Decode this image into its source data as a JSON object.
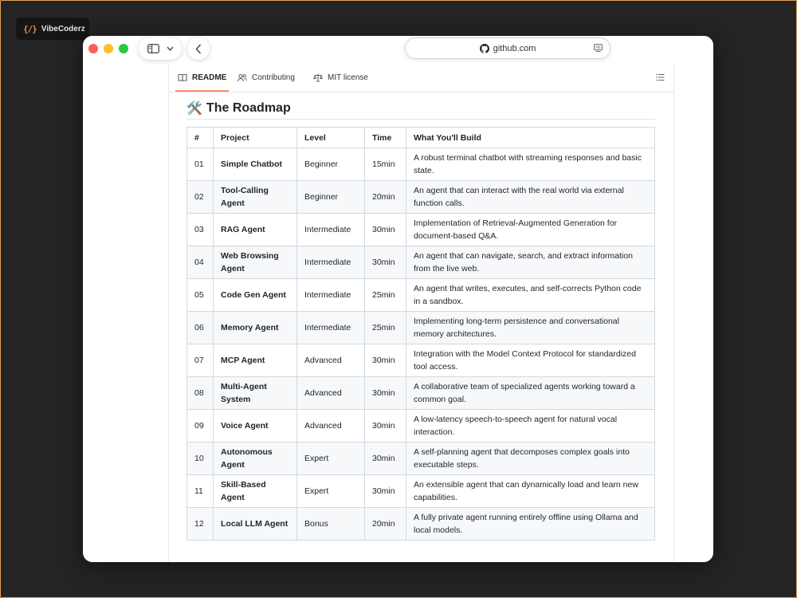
{
  "brand": {
    "icon": "{/}",
    "name": "VibeCoderz"
  },
  "browser": {
    "address": "github.com"
  },
  "tabs": [
    {
      "label": "README",
      "icon": "book-icon",
      "active": true
    },
    {
      "label": "Contributing",
      "icon": "people-icon",
      "active": false
    },
    {
      "label": "MIT license",
      "icon": "scale-icon",
      "active": false
    }
  ],
  "section": {
    "emoji": "🛠️",
    "title": "The Roadmap"
  },
  "table": {
    "headers": [
      "#",
      "Project",
      "Level",
      "Time",
      "What You'll Build"
    ],
    "rows": [
      [
        "01",
        "Simple Chatbot",
        "Beginner",
        "15min",
        "A robust terminal chatbot with streaming responses and basic state."
      ],
      [
        "02",
        "Tool-Calling Agent",
        "Beginner",
        "20min",
        "An agent that can interact with the real world via external function calls."
      ],
      [
        "03",
        "RAG Agent",
        "Intermediate",
        "30min",
        "Implementation of Retrieval-Augmented Generation for document-based Q&A."
      ],
      [
        "04",
        "Web Browsing Agent",
        "Intermediate",
        "30min",
        "An agent that can navigate, search, and extract information from the live web."
      ],
      [
        "05",
        "Code Gen Agent",
        "Intermediate",
        "25min",
        "An agent that writes, executes, and self-corrects Python code in a sandbox."
      ],
      [
        "06",
        "Memory Agent",
        "Intermediate",
        "25min",
        "Implementing long-term persistence and conversational memory architectures."
      ],
      [
        "07",
        "MCP Agent",
        "Advanced",
        "30min",
        "Integration with the Model Context Protocol for standardized tool access."
      ],
      [
        "08",
        "Multi-Agent System",
        "Advanced",
        "30min",
        "A collaborative team of specialized agents working toward a common goal."
      ],
      [
        "09",
        "Voice Agent",
        "Advanced",
        "30min",
        "A low-latency speech-to-speech agent for natural vocal interaction."
      ],
      [
        "10",
        "Autonomous Agent",
        "Expert",
        "30min",
        "A self-planning agent that decomposes complex goals into executable steps."
      ],
      [
        "11",
        "Skill-Based Agent",
        "Expert",
        "30min",
        "An extensible agent that can dynamically load and learn new capabilities."
      ],
      [
        "12",
        "Local LLM Agent",
        "Bonus",
        "20min",
        "A fully private agent running entirely offline using Ollama and local models."
      ]
    ]
  },
  "colors": {
    "accent_tab_underline": "#fd8c73",
    "brand_icon": "#f08c3a",
    "traffic_red": "#ff5f57",
    "traffic_yellow": "#febc2e",
    "traffic_green": "#28c840"
  }
}
